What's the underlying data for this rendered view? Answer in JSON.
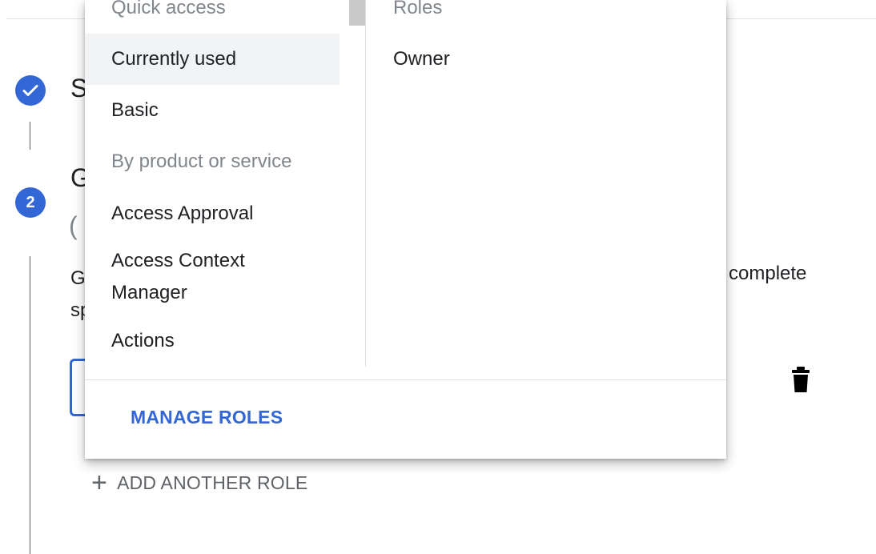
{
  "stepper": {
    "step1_heading_letter": "S",
    "step2_number": "2",
    "step2_heading_letter": "G",
    "step2_sub": "(",
    "description_start": "G\nsp",
    "description_end": "complete"
  },
  "add_another_role": {
    "icon": "plus-icon",
    "label": "ADD ANOTHER ROLE"
  },
  "role_picker": {
    "left_column": {
      "quick_access_header": "Quick access",
      "currently_used": "Currently used",
      "basic": "Basic",
      "by_product_header": "By product or service",
      "access_approval": "Access Approval",
      "access_context_manager": "Access Context Manager",
      "actions": "Actions",
      "selected": "Currently used"
    },
    "right_column": {
      "header": "Roles",
      "roles": [
        "Owner"
      ]
    },
    "footer": {
      "manage_roles": "MANAGE ROLES"
    }
  },
  "colors": {
    "accent": "#3367d6",
    "selected_bg": "#f1f3f4",
    "muted_text": "#80868b"
  }
}
